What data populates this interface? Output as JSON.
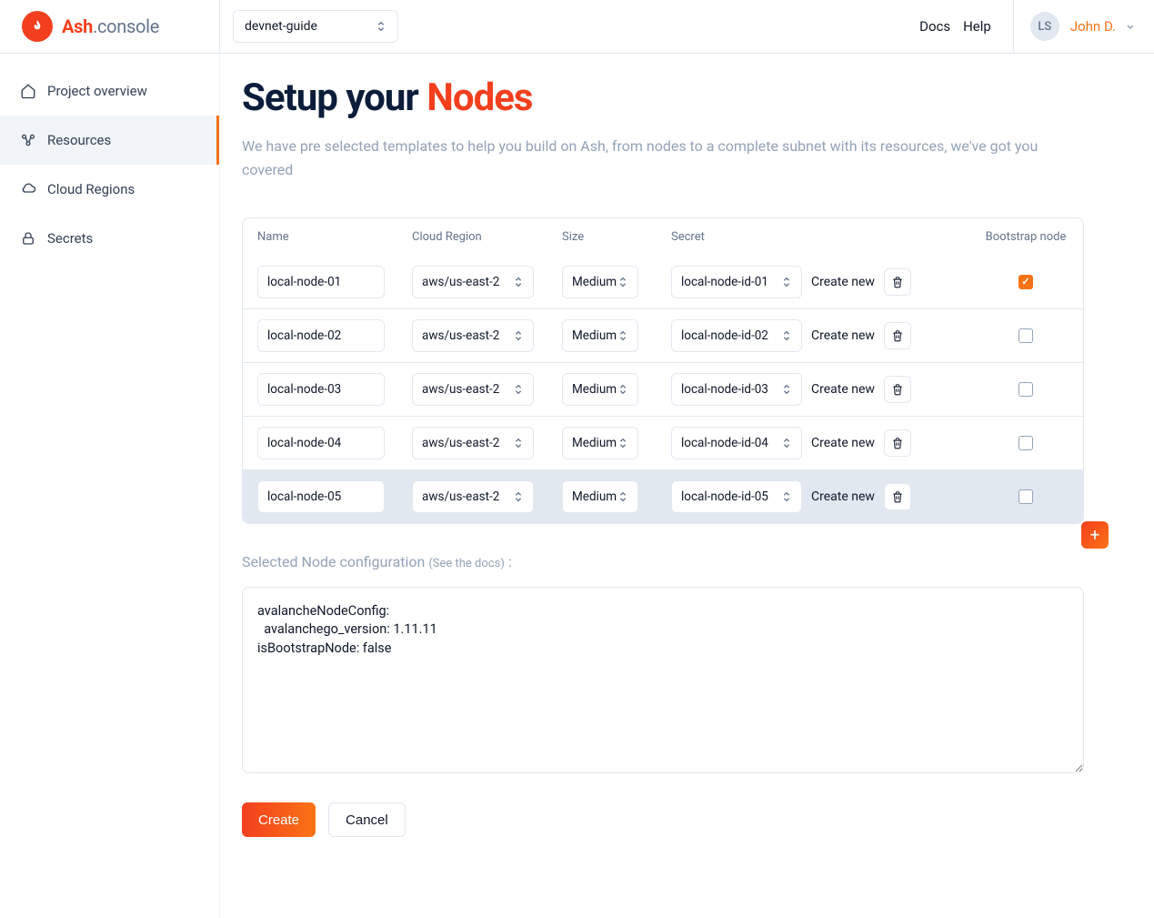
{
  "brand": {
    "name1": "Ash",
    "name2": ".console"
  },
  "project": {
    "selected": "devnet-guide"
  },
  "topnav": {
    "docs": "Docs",
    "help": "Help"
  },
  "user": {
    "initials": "LS",
    "name": "John D."
  },
  "sidebar": {
    "items": [
      {
        "label": "Project overview",
        "icon": "home"
      },
      {
        "label": "Resources",
        "icon": "resources"
      },
      {
        "label": "Cloud Regions",
        "icon": "cloud"
      },
      {
        "label": "Secrets",
        "icon": "lock"
      }
    ]
  },
  "page": {
    "title1": "Setup your ",
    "title2": "Nodes",
    "subtitle": "We have pre selected templates to help you build on Ash, from nodes to a complete subnet with its resources, we've got you covered"
  },
  "table": {
    "headers": {
      "name": "Name",
      "region": "Cloud Region",
      "size": "Size",
      "secret": "Secret",
      "bootstrap": "Bootstrap node"
    },
    "create_new": "Create new",
    "rows": [
      {
        "name": "local-node-01",
        "region": "aws/us-east-2",
        "size": "Medium",
        "secret": "local-node-id-01",
        "bootstrap": true,
        "hover": false
      },
      {
        "name": "local-node-02",
        "region": "aws/us-east-2",
        "size": "Medium",
        "secret": "local-node-id-02",
        "bootstrap": false,
        "hover": false
      },
      {
        "name": "local-node-03",
        "region": "aws/us-east-2",
        "size": "Medium",
        "secret": "local-node-id-03",
        "bootstrap": false,
        "hover": false
      },
      {
        "name": "local-node-04",
        "region": "aws/us-east-2",
        "size": "Medium",
        "secret": "local-node-id-04",
        "bootstrap": false,
        "hover": false
      },
      {
        "name": "local-node-05",
        "region": "aws/us-east-2",
        "size": "Medium",
        "secret": "local-node-id-05",
        "bootstrap": false,
        "hover": true
      }
    ]
  },
  "config": {
    "label": "Selected Node configuration ",
    "docs_link": "(See the docs)",
    "colon": " :",
    "text": "avalancheNodeConfig:\n  avalanchego_version: 1.11.11\nisBootstrapNode: false"
  },
  "buttons": {
    "create": "Create",
    "cancel": "Cancel"
  },
  "plus": "+"
}
